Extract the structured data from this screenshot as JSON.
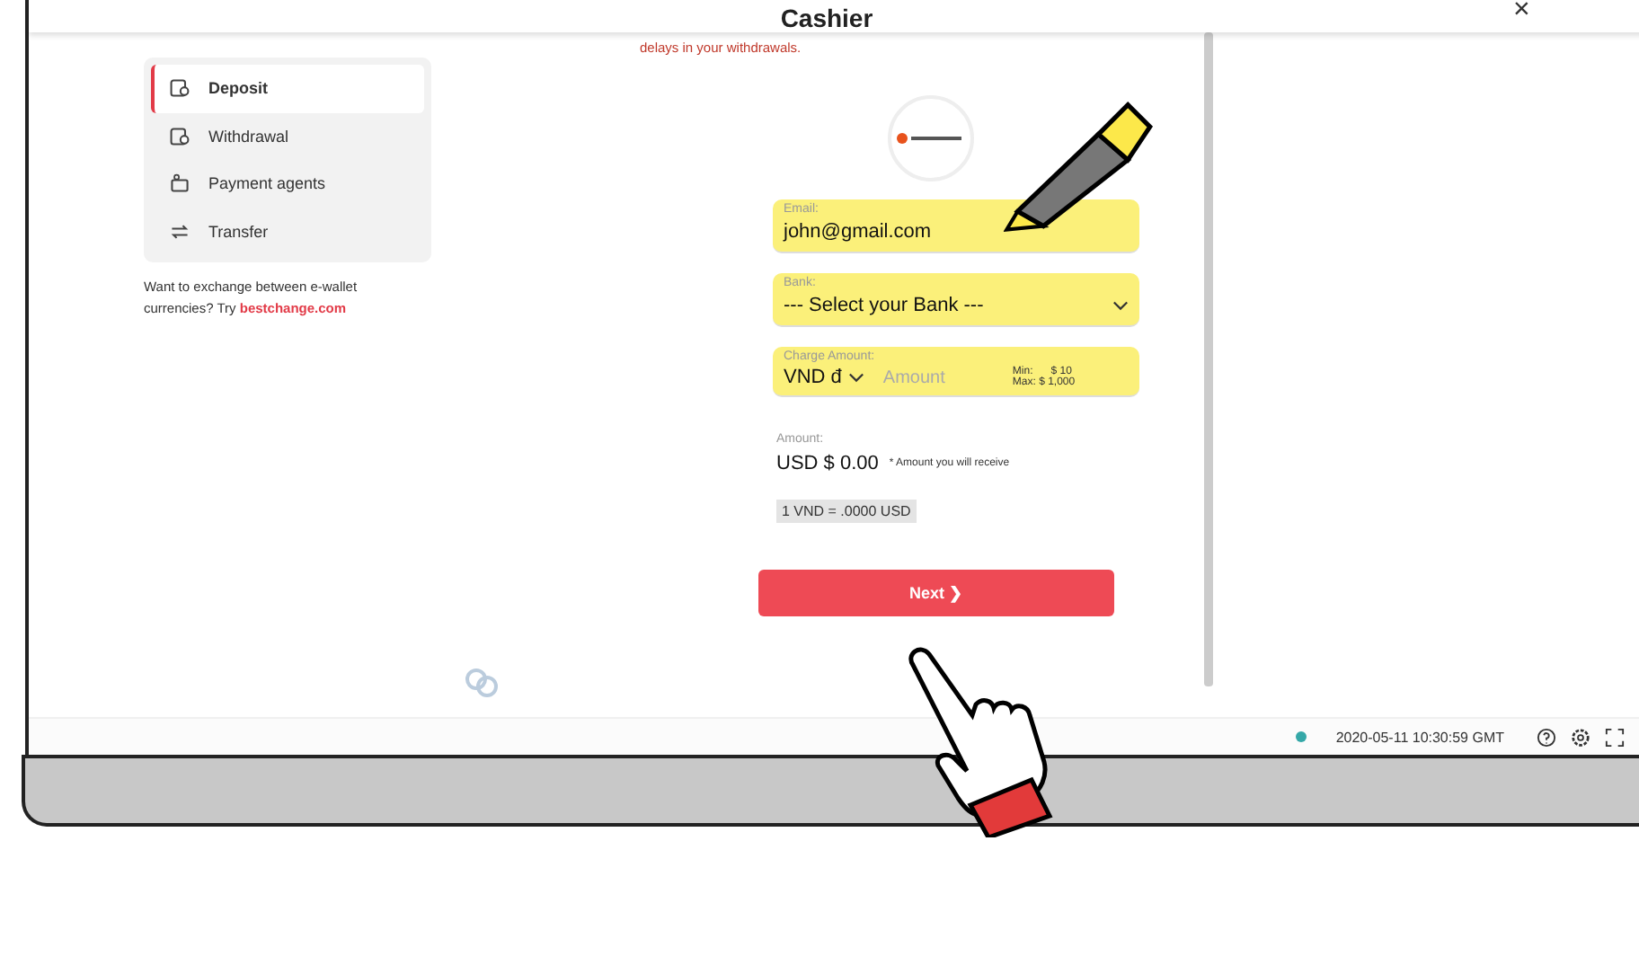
{
  "window": {
    "title": "Cashier",
    "close": "×"
  },
  "sidebar": {
    "items": [
      {
        "label": "Deposit",
        "selected": true
      },
      {
        "label": "Withdrawal",
        "selected": false
      },
      {
        "label": "Payment agents",
        "selected": false
      },
      {
        "label": "Transfer",
        "selected": false
      }
    ],
    "note": "Want to exchange between e-wallet currencies? Try",
    "link": "bestchange.com"
  },
  "form": {
    "notice": "delays in your withdrawals.",
    "email": {
      "label": "Email:",
      "value": "john@gmail.com",
      "highlighted": true
    },
    "bank": {
      "label": "Bank:",
      "value": "--- Select your Bank ---",
      "highlighted": true
    },
    "charge": {
      "label": "Charge Amount:",
      "currency": "VND đ",
      "placeholder": "Amount",
      "min_label": "Min:",
      "min": "$ 10",
      "max": "Max: $ 1,000",
      "highlighted": true
    },
    "receive": {
      "label": "Amount:",
      "value": "USD $ 0.00",
      "note": "* Amount you will receive"
    },
    "rate": "1 VND = .0000 USD",
    "next": "Next ❯"
  },
  "status_bar": {
    "time": "2020-05-11 10:30:59 GMT"
  }
}
